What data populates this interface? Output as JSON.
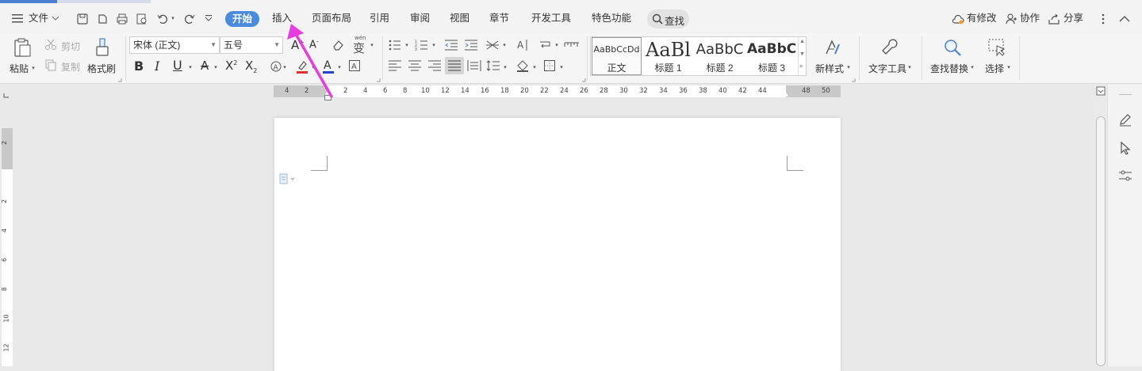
{
  "menu": {
    "file": "文件",
    "tabs": [
      "开始",
      "插入",
      "页面布局",
      "引用",
      "审阅",
      "视图",
      "章节",
      "开发工具",
      "特色功能"
    ],
    "search": "查找",
    "right": {
      "changes": "有修改",
      "collab": "协作",
      "share": "分享"
    }
  },
  "ribbon": {
    "paste": "粘贴",
    "cut": "剪切",
    "copy": "复制",
    "format_painter": "格式刷",
    "font_name": "宋体 (正文)",
    "font_size": "五号",
    "wen": "wén",
    "styles": [
      {
        "sample": "AaBbCcDd",
        "name": "正文"
      },
      {
        "sample": "AaBl",
        "name": "标题 1"
      },
      {
        "sample": "AaBbC",
        "name": "标题 2"
      },
      {
        "sample": "AaBbC",
        "name": "标题 3"
      }
    ],
    "new_style": "新样式",
    "text_tools": "文字工具",
    "find_replace": "查找替换",
    "select": "选择"
  },
  "ruler": {
    "left_ticks": [
      "4",
      "2"
    ],
    "ticks": [
      "2",
      "4",
      "6",
      "8",
      "10",
      "12",
      "14",
      "16",
      "18",
      "20",
      "22",
      "24",
      "26",
      "28",
      "30",
      "32",
      "34",
      "36",
      "38",
      "40",
      "42",
      "44"
    ],
    "right_ticks": [
      "48",
      "50"
    ],
    "vticks": [
      "2",
      "2",
      "4",
      "6",
      "8",
      "10",
      "12"
    ]
  },
  "colors": {
    "accent": "#4a8be0",
    "arrow": "#e83ce0",
    "highlight": "#e03030",
    "font_color": "#2244cc"
  }
}
